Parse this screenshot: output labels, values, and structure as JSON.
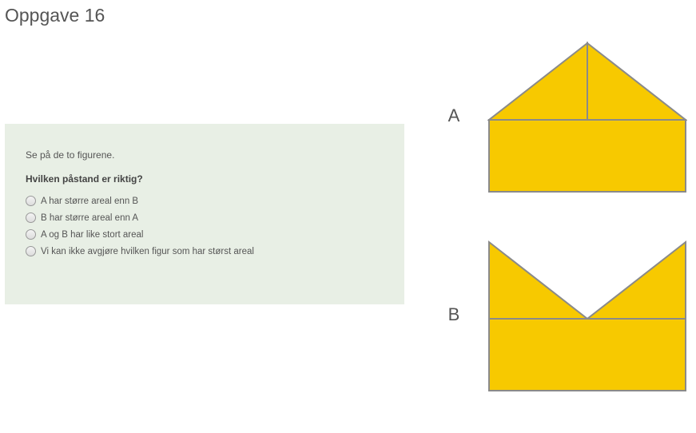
{
  "title": "Oppgave 16",
  "question": {
    "intro": "Se på de to figurene.",
    "prompt": "Hvilken påstand er riktig?",
    "options": [
      "A har større areal enn B",
      "B har større areal enn A",
      "A og B har like stort areal",
      "Vi kan ikke avgjøre hvilken figur som har størst areal"
    ]
  },
  "figures": {
    "labelA": "A",
    "labelB": "B"
  },
  "colors": {
    "shapeFill": "#f7c900",
    "shapeStroke": "#8a8a8a",
    "panelBg": "#e8efe5"
  }
}
